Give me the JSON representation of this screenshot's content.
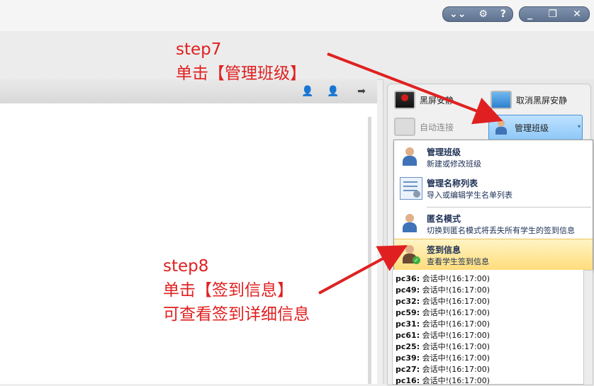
{
  "window_controls": {
    "group1": [
      "⌄⌄",
      "⚙",
      "?"
    ],
    "group2": [
      "_",
      "❐",
      "✕"
    ]
  },
  "toolbar_buttons": {
    "black_screen": "黑屏安静",
    "cancel_black_screen": "取消黑屏安静",
    "auto_connect": "自动连接",
    "manage_class": "管理班级"
  },
  "menu": [
    {
      "title": "管理班级",
      "desc": "新建或修改班级"
    },
    {
      "title": "管理名称列表",
      "desc": "导入或编辑学生名单列表"
    },
    {
      "title": "匿名模式",
      "desc": "切换到匿名模式将丢失所有学生的签到信息"
    },
    {
      "title": "签到信息",
      "desc": "查看学生签到信息"
    }
  ],
  "log_lines": [
    {
      "pc": "pc36:",
      "msg": "会话中!(16:17:00)"
    },
    {
      "pc": "pc49:",
      "msg": "会话中!(16:17:00)"
    },
    {
      "pc": "pc32:",
      "msg": "会话中!(16:17:00)"
    },
    {
      "pc": "pc59:",
      "msg": "会话中!(16:17:00)"
    },
    {
      "pc": "pc31:",
      "msg": "会话中!(16:17:00)"
    },
    {
      "pc": "pc61:",
      "msg": "会话中!(16:17:00)"
    },
    {
      "pc": "pc25:",
      "msg": "会话中!(16:17:00)"
    },
    {
      "pc": "pc39:",
      "msg": "会话中!(16:17:00)"
    },
    {
      "pc": "pc27:",
      "msg": "会话中!(16:17:00)"
    },
    {
      "pc": "pc16:",
      "msg": "会话中!(16:17:00)"
    }
  ],
  "annotations": {
    "step7_line1": "step7",
    "step7_line2": "单击【管理班级】",
    "step8_line1": "step8",
    "step8_line2": "单击【签到信息】",
    "step8_line3": "可查看签到详细信息"
  },
  "colors": {
    "annotation_red": "#e02020",
    "highlight_yellow": "#ffdc7a",
    "selected_blue": "#8ec8f7",
    "menu_text": "#1c2f55"
  }
}
